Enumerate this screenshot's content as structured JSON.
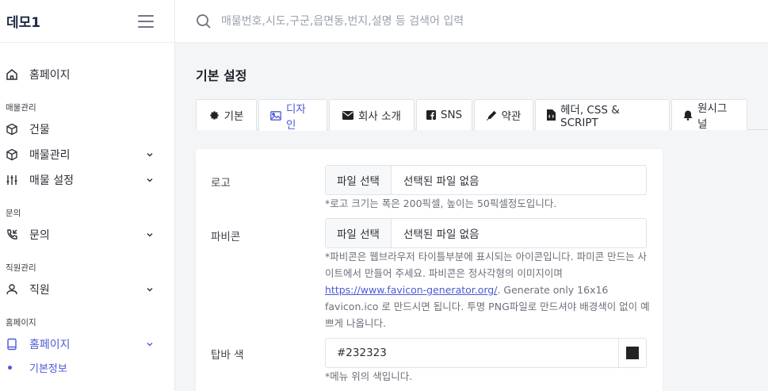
{
  "app": {
    "title": "데모1"
  },
  "search": {
    "placeholder": "매물번호,시도,구군,읍면동,번지,설명 등 검색어 입력"
  },
  "sidebar": {
    "home": "홈페이지",
    "sections": [
      {
        "title": "매물관리",
        "items": [
          "건물",
          "매물관리",
          "매물 설정"
        ]
      },
      {
        "title": "문의",
        "items": [
          "문의"
        ]
      },
      {
        "title": "직원관리",
        "items": [
          "직원"
        ]
      },
      {
        "title": "홈페이지",
        "items": [
          "홈페이지"
        ],
        "sub": [
          "기본정보"
        ]
      }
    ]
  },
  "page": {
    "title": "기본 설정"
  },
  "tabs": [
    {
      "label": "기본",
      "icon": "gear-icon"
    },
    {
      "label": "디자인",
      "icon": "image-icon",
      "active": true
    },
    {
      "label": "회사 소개",
      "icon": "envelope-icon"
    },
    {
      "label": "SNS",
      "icon": "facebook-icon"
    },
    {
      "label": "약관",
      "icon": "pen-icon"
    },
    {
      "label": "헤더, CSS & SCRIPT",
      "icon": "file-code-icon"
    },
    {
      "label": "원시그널",
      "icon": "bell-icon"
    }
  ],
  "form": {
    "logo": {
      "label": "로고",
      "button": "파일 선택",
      "status": "선택된 파일 없음",
      "help": "*로고 크기는 폭은 200픽셀, 높이는 50픽셀정도입니다."
    },
    "favicon": {
      "label": "파비콘",
      "button": "파일 선택",
      "status": "선택된 파일 없음",
      "help_1": "*파비콘은 웹브라우저 타이틀부분에 표시되는 아이콘입니다. 파미콘 만드는 사이트에서 만들어 주세요. 파비콘은 정사각형의 이미지이며 ",
      "help_link": "https://www.favicon-generator.org/",
      "help_2": ". Generate only 16x16 favicon.ico 로 만드시면 됩니다. 투명 PNG파일로 만드셔야 배경색이 없이 예쁘게 나옵니다."
    },
    "topbar_color": {
      "label": "탑바 색",
      "value": "#232323",
      "help": "*메뉴 위의 색입니다."
    }
  },
  "colors": {
    "accent": "#4b5bd6",
    "swatch": "#232323"
  }
}
